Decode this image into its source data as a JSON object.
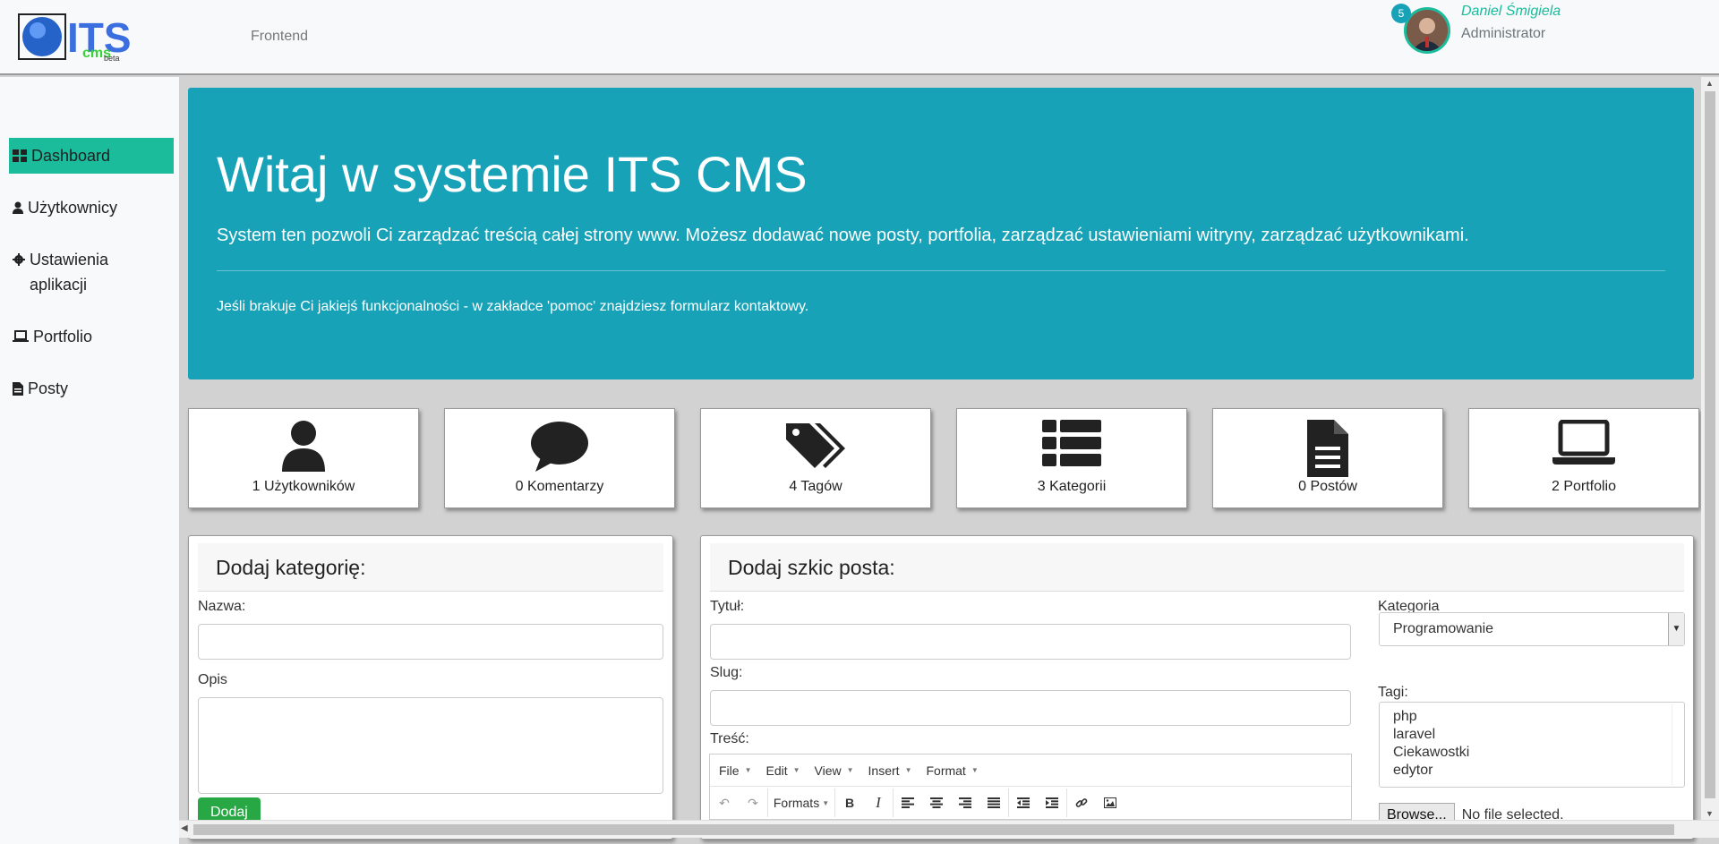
{
  "header": {
    "logo_text": "ITS cms beta",
    "nav_frontend": "Frontend",
    "notification_count": "5",
    "user_name": "Daniel Śmigiela",
    "user_role": "Administrator"
  },
  "sidebar": {
    "items": [
      {
        "label": "Dashboard",
        "icon": "dashboard-icon",
        "active": true
      },
      {
        "label": "Użytkownicy",
        "icon": "user-icon",
        "active": false
      },
      {
        "label": "Ustawienia aplikacji",
        "icon": "gear-icon",
        "active": false
      },
      {
        "label": "Portfolio",
        "icon": "laptop-icon",
        "active": false
      },
      {
        "label": "Posty",
        "icon": "file-icon",
        "active": false
      }
    ]
  },
  "jumbotron": {
    "title": "Witaj w systemie ITS CMS",
    "lead": "System ten pozwoli Ci zarządzać treścią całej strony www. Możesz dodawać nowe posty, portfolia, zarządzać ustawieniami witryny, zarządzać użytkownikami.",
    "note": "Jeśli brakuje Ci jakiejś funkcjonalności - w zakładce 'pomoc' znajdziesz formularz kontaktowy."
  },
  "stats": [
    {
      "label": "1 Użytkowników",
      "icon": "user-icon"
    },
    {
      "label": "0 Komentarzy",
      "icon": "comment-icon"
    },
    {
      "label": "4 Tagów",
      "icon": "tags-icon"
    },
    {
      "label": "3 Kategorii",
      "icon": "list-icon"
    },
    {
      "label": "0 Postów",
      "icon": "file-icon"
    },
    {
      "label": "2 Portfolio",
      "icon": "laptop-icon"
    }
  ],
  "category_form": {
    "title": "Dodaj kategorię:",
    "name_label": "Nazwa:",
    "desc_label": "Opis",
    "submit": "Dodaj"
  },
  "post_form": {
    "title": "Dodaj szkic posta:",
    "title_label": "Tytuł:",
    "slug_label": "Slug:",
    "content_label": "Treść:",
    "category_label": "Kategoria",
    "category_selected": "Programowanie",
    "tags_label": "Tagi:",
    "tags": [
      "php",
      "laravel",
      "Ciekawostki",
      "edytor"
    ],
    "file_button": "Browse...",
    "file_status": "No file selected."
  },
  "editor": {
    "menus": [
      "File",
      "Edit",
      "View",
      "Insert",
      "Format"
    ],
    "formats_label": "Formats"
  },
  "colors": {
    "accent": "#1abc9c",
    "jumbotron": "#17a2b8",
    "add_button": "#28a745"
  }
}
